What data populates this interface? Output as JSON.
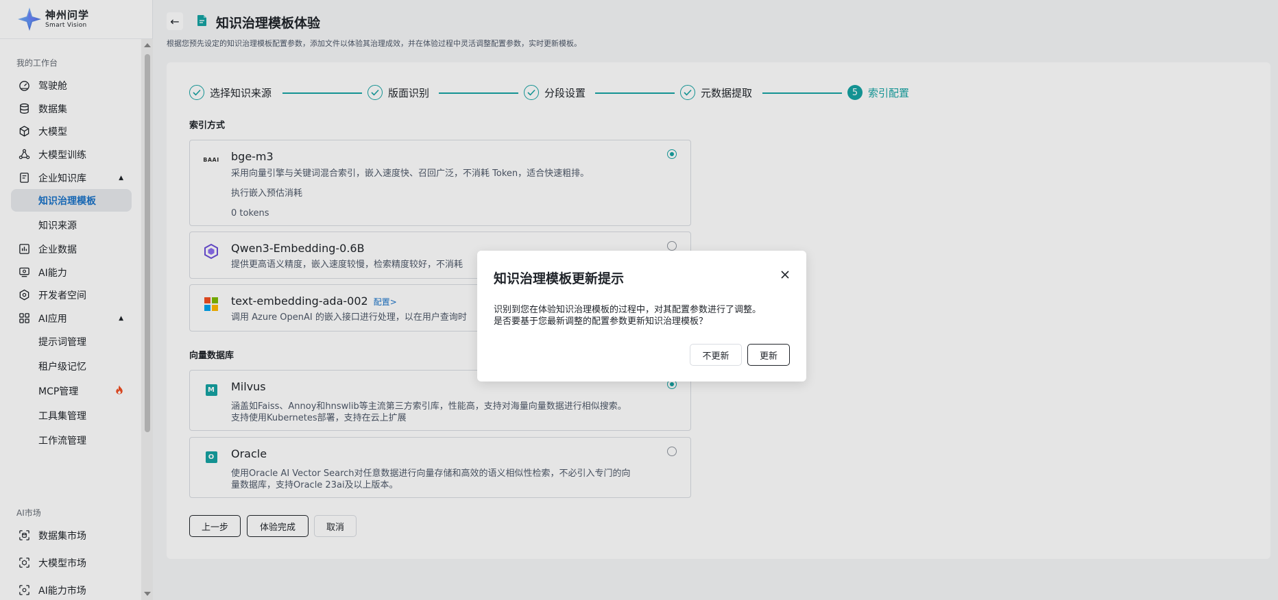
{
  "brand": {
    "name_cn": "神州问学",
    "name_en": "Smart Vision"
  },
  "sidebar": {
    "section_workbench": "我的工作台",
    "items": [
      {
        "label": "驾驶舱"
      },
      {
        "label": "数据集"
      },
      {
        "label": "大模型"
      },
      {
        "label": "大模型训练"
      },
      {
        "label": "企业知识库"
      },
      {
        "label": "企业数据"
      },
      {
        "label": "AI能力"
      },
      {
        "label": "开发者空间"
      },
      {
        "label": "AI应用"
      }
    ],
    "kb_sub": [
      {
        "label": "知识治理模板",
        "active": true
      },
      {
        "label": "知识来源"
      }
    ],
    "ai_sub": [
      {
        "label": "提示词管理"
      },
      {
        "label": "租户级记忆"
      },
      {
        "label": "MCP管理"
      },
      {
        "label": "工具集管理"
      },
      {
        "label": "工作流管理"
      }
    ],
    "section_market": "AI市场",
    "market": [
      {
        "label": "数据集市场"
      },
      {
        "label": "大模型市场"
      },
      {
        "label": "AI能力市场"
      }
    ]
  },
  "header": {
    "title": "知识治理模板体验",
    "description": "根据您预先设定的知识治理模板配置参数，添加文件以体验其治理成效，并在体验过程中灵活调整配置参数，实时更新模板。"
  },
  "steps": [
    {
      "label": "选择知识来源",
      "status": "done"
    },
    {
      "label": "版面识别",
      "status": "done"
    },
    {
      "label": "分段设置",
      "status": "done"
    },
    {
      "label": "元数据提取",
      "status": "done"
    },
    {
      "label": "索引配置",
      "status": "current",
      "number": "5"
    }
  ],
  "index_section": {
    "title": "索引方式",
    "options": [
      {
        "name": "bge-m3",
        "logo_text": "BAAI",
        "desc": "采用向量引擎与关键词混合索引，嵌入速度快、召回广泛，不消耗 Token，适合快速粗排。",
        "cost_label": "执行嵌入预估消耗",
        "cost_value": "0 tokens",
        "selected": true
      },
      {
        "name": "Qwen3-Embedding-0.6B",
        "desc": "提供更高语义精度，嵌入速度较慢，检索精度较好，不消耗",
        "selected": false
      },
      {
        "name": "text-embedding-ada-002",
        "config_link": "配置>",
        "desc": "调用 Azure OpenAI 的嵌入接口进行处理，以在用户查询时",
        "selected": false
      }
    ]
  },
  "vector_section": {
    "title": "向量数据库",
    "options": [
      {
        "name": "Milvus",
        "logo_text": "M",
        "desc_lines": [
          "涵盖如Faiss、Annoy和hnswlib等主流第三方索引库，性能高，支持对海量向量数据进行相似搜索。",
          "支持使用Kubernetes部署，支持在云上扩展"
        ],
        "selected": true
      },
      {
        "name": "Oracle",
        "logo_text": "O",
        "desc_lines": [
          "使用Oracle AI Vector Search对任意数据进行向量存储和高效的语义相似性检索，不必引入专门的向",
          "量数据库，支持Oracle 23ai及以上版本。"
        ],
        "selected": false
      }
    ]
  },
  "actions": {
    "prev": "上一步",
    "finish": "体验完成",
    "cancel": "取消"
  },
  "dialog": {
    "title": "知识治理模板更新提示",
    "body_lines": [
      "识别到您在体验知识治理模板的过程中，对其配置参数进行了调整。",
      "是否要基于您最新调整的配置参数更新知识治理模板？"
    ],
    "cancel": "不更新",
    "confirm": "更新"
  },
  "colors": {
    "accent": "#16a3a3",
    "link": "#1a73c8",
    "text": "#1f2329"
  }
}
